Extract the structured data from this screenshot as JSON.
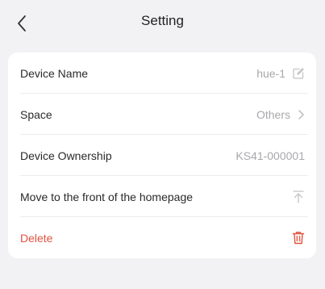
{
  "header": {
    "title": "Setting",
    "back_icon": "chevron-left-icon"
  },
  "rows": [
    {
      "label": "Device Name",
      "value": "hue-1",
      "icon": "edit-icon"
    },
    {
      "label": "Space",
      "value": "Others",
      "icon": "chevron-right-icon"
    },
    {
      "label": "Device Ownership",
      "value": "KS41-000001"
    },
    {
      "label": "Move to the front of the homepage",
      "icon": "pin-to-top-icon"
    },
    {
      "label": "Delete",
      "icon": "trash-icon"
    }
  ],
  "colors": {
    "background": "#f2f2f4",
    "card": "#ffffff",
    "danger": "#e0533f",
    "muted": "#a8a8ac"
  }
}
